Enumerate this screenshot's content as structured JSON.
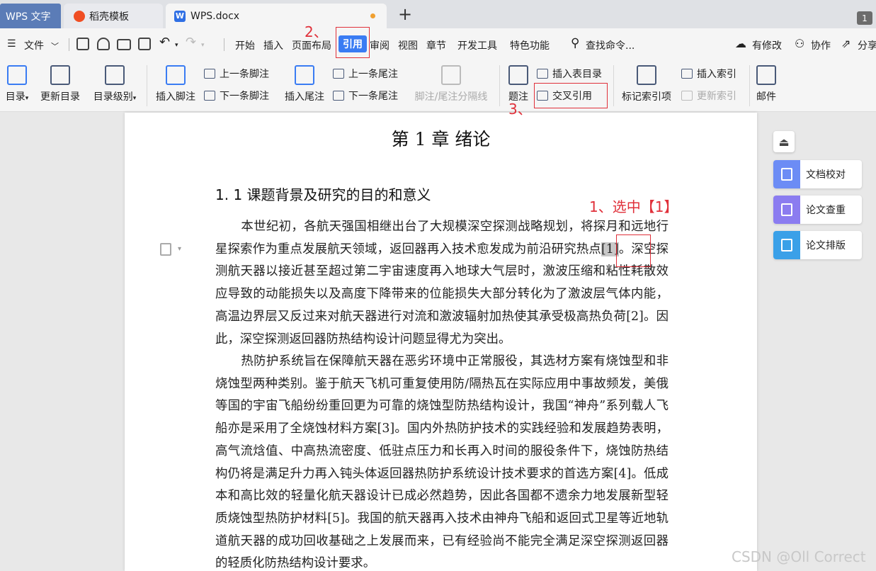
{
  "tabs": {
    "app": "WPS 文字",
    "docer": "稻壳模板",
    "doc": "WPS.docx",
    "new_tab": "+",
    "count": "1"
  },
  "menu": {
    "file": "文件",
    "items": [
      "开始",
      "插入",
      "页面布局",
      "引用",
      "审阅",
      "视图",
      "章节",
      "开发工具",
      "特色功能"
    ],
    "active": "引用",
    "search": "查找命令...",
    "modified": "有修改",
    "collab": "协作",
    "share": "分享"
  },
  "ribbon": {
    "toc": "目录",
    "update_toc": "更新目录",
    "toc_level": "目录级别",
    "insert_footnote": "插入脚注",
    "prev_footnote": "上一条脚注",
    "next_footnote": "下一条脚注",
    "insert_endnote": "插入尾注",
    "prev_endnote": "上一条尾注",
    "next_endnote": "下一条尾注",
    "separator": "脚注/尾注分隔线",
    "caption": "题注",
    "insert_table_toc": "插入表目录",
    "cross_ref": "交叉引用",
    "mark_index": "标记索引项",
    "insert_index": "插入索引",
    "update_index": "更新索引",
    "mail": "邮件"
  },
  "document": {
    "chapter_title": "第 1 章  绪论",
    "section_title": "1. 1  课题背景及研究的目的和意义",
    "p1_before": "本世纪初，各航天强国相继出台了大规模深空探测战略规划，将探月和远地行星探索作为重点发展航天领域，返回器再入技术愈发成为前沿研究热点",
    "p1_ref": "[1]",
    "p1_after": "。深空探测航天器以接近甚至超过第二宇宙速度再入地球大气层时，激波压缩和粘性耗散效应导致的动能损失以及高度下降带来的位能损失大部分转化为了激波层气体内能，高温边界层又反过来对航天器进行对流和激波辐射加热使其承受极高热负荷[2]。因此，深空探测返回器防热结构设计问题显得尤为突出。",
    "p2": "热防护系统旨在保障航天器在恶劣环境中正常服役，其选材方案有烧蚀型和非烧蚀型两种类别。鉴于航天飞机可重复使用防/隔热瓦在实际应用中事故频发，美俄等国的宇宙飞船纷纷重回更为可靠的烧蚀型防热结构设计，我国“神舟”系列载人飞船亦是采用了全烧蚀材料方案[3]。国内外热防护技术的实践经验和发展趋势表明，高气流焓值、中高热流密度、低驻点压力和长再入时间的服役条件下，烧蚀防热结构仍将是满足升力再入钝头体返回器热防护系统设计技术要求的首选方案[4]。低成本和高比效的轻量化航天器设计已成必然趋势，因此各国都不遗余力地发展新型轻质烧蚀型热防护材料[5]。我国的航天器再入技术由神舟飞船和返回式卫星等近地轨道航天器的成功回收基础之上发展而来，已有经验尚不能完全满足深空探测返回器的轻质化防热结构设计要求。"
  },
  "annotations": {
    "step1": "1、选中【1】",
    "step2": "2、",
    "step3": "3、"
  },
  "side_panel": {
    "proofread": "文档校对",
    "plagiarism": "论文查重",
    "layout": "论文排版",
    "colors": {
      "proofread": "#6c8cf5",
      "plagiarism": "#8b7cf0",
      "layout": "#3aa0e8"
    }
  },
  "watermark": "CSDN @Oll Correct"
}
